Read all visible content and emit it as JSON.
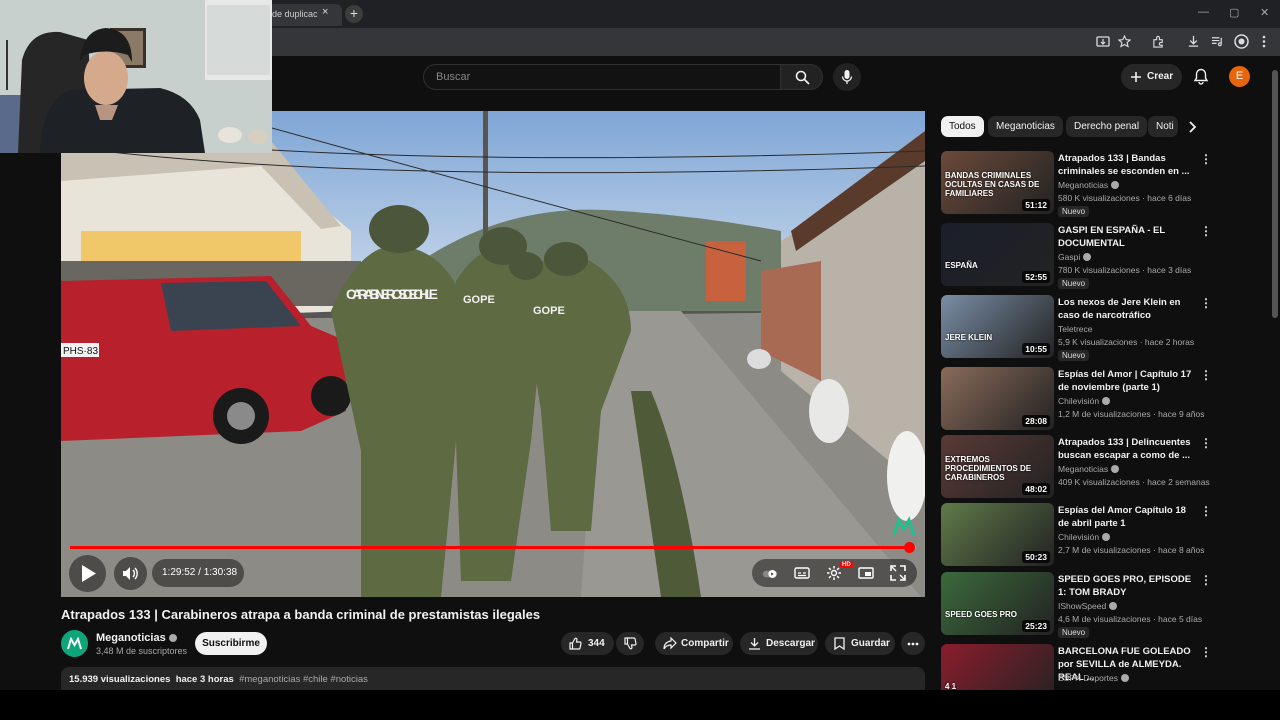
{
  "browser": {
    "tab_title": "de duplicac",
    "tab_close": "×",
    "new_tab": "+",
    "window_controls": [
      "—",
      "▢",
      "✕"
    ]
  },
  "topbar": {
    "search_placeholder": "Buscar",
    "create_label": "Crear",
    "avatar_initial": "E"
  },
  "player": {
    "current_time": "1:29:52",
    "duration": "1:30:38",
    "time_display": "1:29:52 / 1:30:38",
    "progress_fraction": 0.992,
    "watermark": "Mega logo",
    "scene_text_vest_1": "CARABINEROS DE CHILE",
    "scene_text_vest_2": "GOPE",
    "scene_text_vest_3": "GOPE",
    "plate": "PHS·83",
    "settings_badge": "HD"
  },
  "video": {
    "title": "Atrapados 133 | Carabineros atrapa a banda criminal de prestamistas ilegales",
    "channel": "Meganoticias",
    "subscribers": "3,48 M de suscriptores",
    "subscribe_label": "Suscribirme",
    "likes": "344",
    "share_label": "Compartir",
    "download_label": "Descargar",
    "save_label": "Guardar",
    "views": "15.939 visualizaciones",
    "date": "hace 3 horas",
    "tags": "#meganoticias #chile #noticias"
  },
  "chips": [
    "Todos",
    "Meganoticias",
    "Derecho penal",
    "Noti"
  ],
  "recommendations": [
    {
      "title": "Atrapados 133 | Bandas criminales se esconden en ...",
      "channel": "Meganoticias",
      "verified": true,
      "meta": "580 K visualizaciones · hace 6 días",
      "badge": "Nuevo",
      "duration": "51:12",
      "thumb_text": "BANDAS CRIMINALES OCULTAS EN CASAS DE FAMILIARES",
      "thumb_color": "#6b4a3a"
    },
    {
      "title": "GASPI EN ESPAÑA - EL DOCUMENTAL",
      "channel": "Gaspi",
      "verified": true,
      "meta": "780 K visualizaciones · hace 3 días",
      "badge": "Nuevo",
      "duration": "52:55",
      "thumb_text": "ESPAÑA",
      "thumb_color": "#1b1f2b"
    },
    {
      "title": "Los nexos de Jere Klein en caso de narcotráfico",
      "channel": "Teletrece",
      "verified": false,
      "meta": "5,9 K visualizaciones · hace 2 horas",
      "badge": "Nuevo",
      "duration": "10:55",
      "thumb_text": "JERE KLEIN",
      "thumb_color": "#7a8ea6"
    },
    {
      "title": "Espías del Amor | Capítulo 17 de noviembre (parte 1)",
      "channel": "Chilevisión",
      "verified": true,
      "meta": "1,2 M de visualizaciones · hace 9 años",
      "badge": "",
      "duration": "28:08",
      "thumb_text": "",
      "thumb_color": "#8a6b5a"
    },
    {
      "title": "Atrapados 133 | Delincuentes buscan escapar a como de ...",
      "channel": "Meganoticias",
      "verified": true,
      "meta": "409 K visualizaciones · hace 2 semanas",
      "badge": "",
      "duration": "48:02",
      "thumb_text": "EXTREMOS PROCEDIMIENTOS DE CARABINEROS",
      "thumb_color": "#5a3a36"
    },
    {
      "title": "Espías del Amor  Capítulo 18 de abril parte 1",
      "channel": "Chilevisión",
      "verified": true,
      "meta": "2,7 M de visualizaciones · hace 8 años",
      "badge": "",
      "duration": "50:23",
      "thumb_text": "",
      "thumb_color": "#5f7a4a"
    },
    {
      "title": "SPEED GOES PRO, EPISODE 1: TOM BRADY",
      "channel": "IShowSpeed",
      "verified": true,
      "meta": "4,6 M de visualizaciones · hace 5 días",
      "badge": "Nuevo",
      "duration": "25:23",
      "thumb_text": "SPEED GOES PRO",
      "thumb_color": "#3c6a3c"
    },
    {
      "title": "BARCELONA FUE GOLEADO por SEVILLA de ALMEYDA. REAL ...",
      "channel": "ESPN Deportes",
      "verified": true,
      "meta": "",
      "badge": "",
      "duration": "",
      "thumb_text": "4 1",
      "thumb_color": "#8b1d2c"
    }
  ]
}
